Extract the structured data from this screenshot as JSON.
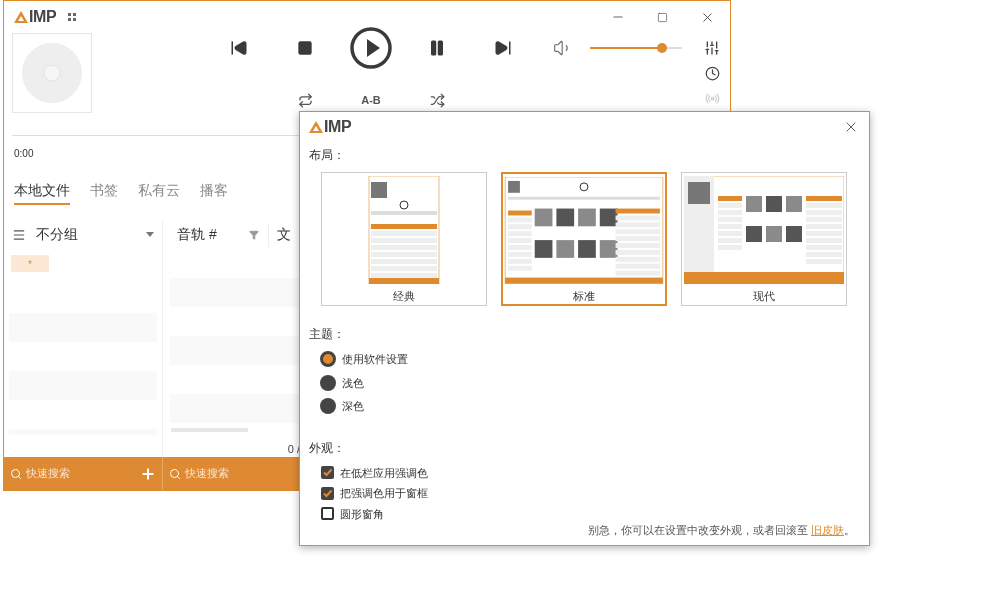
{
  "main_window": {
    "logo": "IMP",
    "time": "0:00",
    "ab_label": "A-B",
    "volume": {
      "level": 0.78
    },
    "tabs": [
      {
        "label": "本地文件",
        "selected": true
      },
      {
        "label": "书签",
        "selected": false
      },
      {
        "label": "私有云",
        "selected": false
      },
      {
        "label": "播客",
        "selected": false
      }
    ],
    "group_panel": {
      "title": "不分组",
      "chip": "*",
      "search_placeholder": "快速搜索"
    },
    "track_panel": {
      "columns": [
        "音轨 #",
        "文"
      ],
      "count": "0 /",
      "search_placeholder": "快速搜索"
    }
  },
  "dialog": {
    "logo": "IMP",
    "layout_label": "布局：",
    "layouts": [
      {
        "label": "经典",
        "kind": "classic",
        "selected": false
      },
      {
        "label": "标准",
        "kind": "standard",
        "selected": true
      },
      {
        "label": "现代",
        "kind": "modern",
        "selected": false
      }
    ],
    "theme_label": "主题：",
    "themes": [
      {
        "label": "使用软件设置",
        "selected": true
      },
      {
        "label": "浅色",
        "selected": false
      },
      {
        "label": "深色",
        "selected": false
      }
    ],
    "appearance_label": "外观：",
    "options": [
      {
        "label": "在低栏应用强调色",
        "checked": true
      },
      {
        "label": "把强调色用于窗框",
        "checked": true
      },
      {
        "label": "圆形窗角",
        "checked": false
      }
    ],
    "footer": {
      "text": "别急，你可以在设置中改变外观，或者回滚至",
      "link": "旧皮肤",
      "end": "。"
    }
  }
}
